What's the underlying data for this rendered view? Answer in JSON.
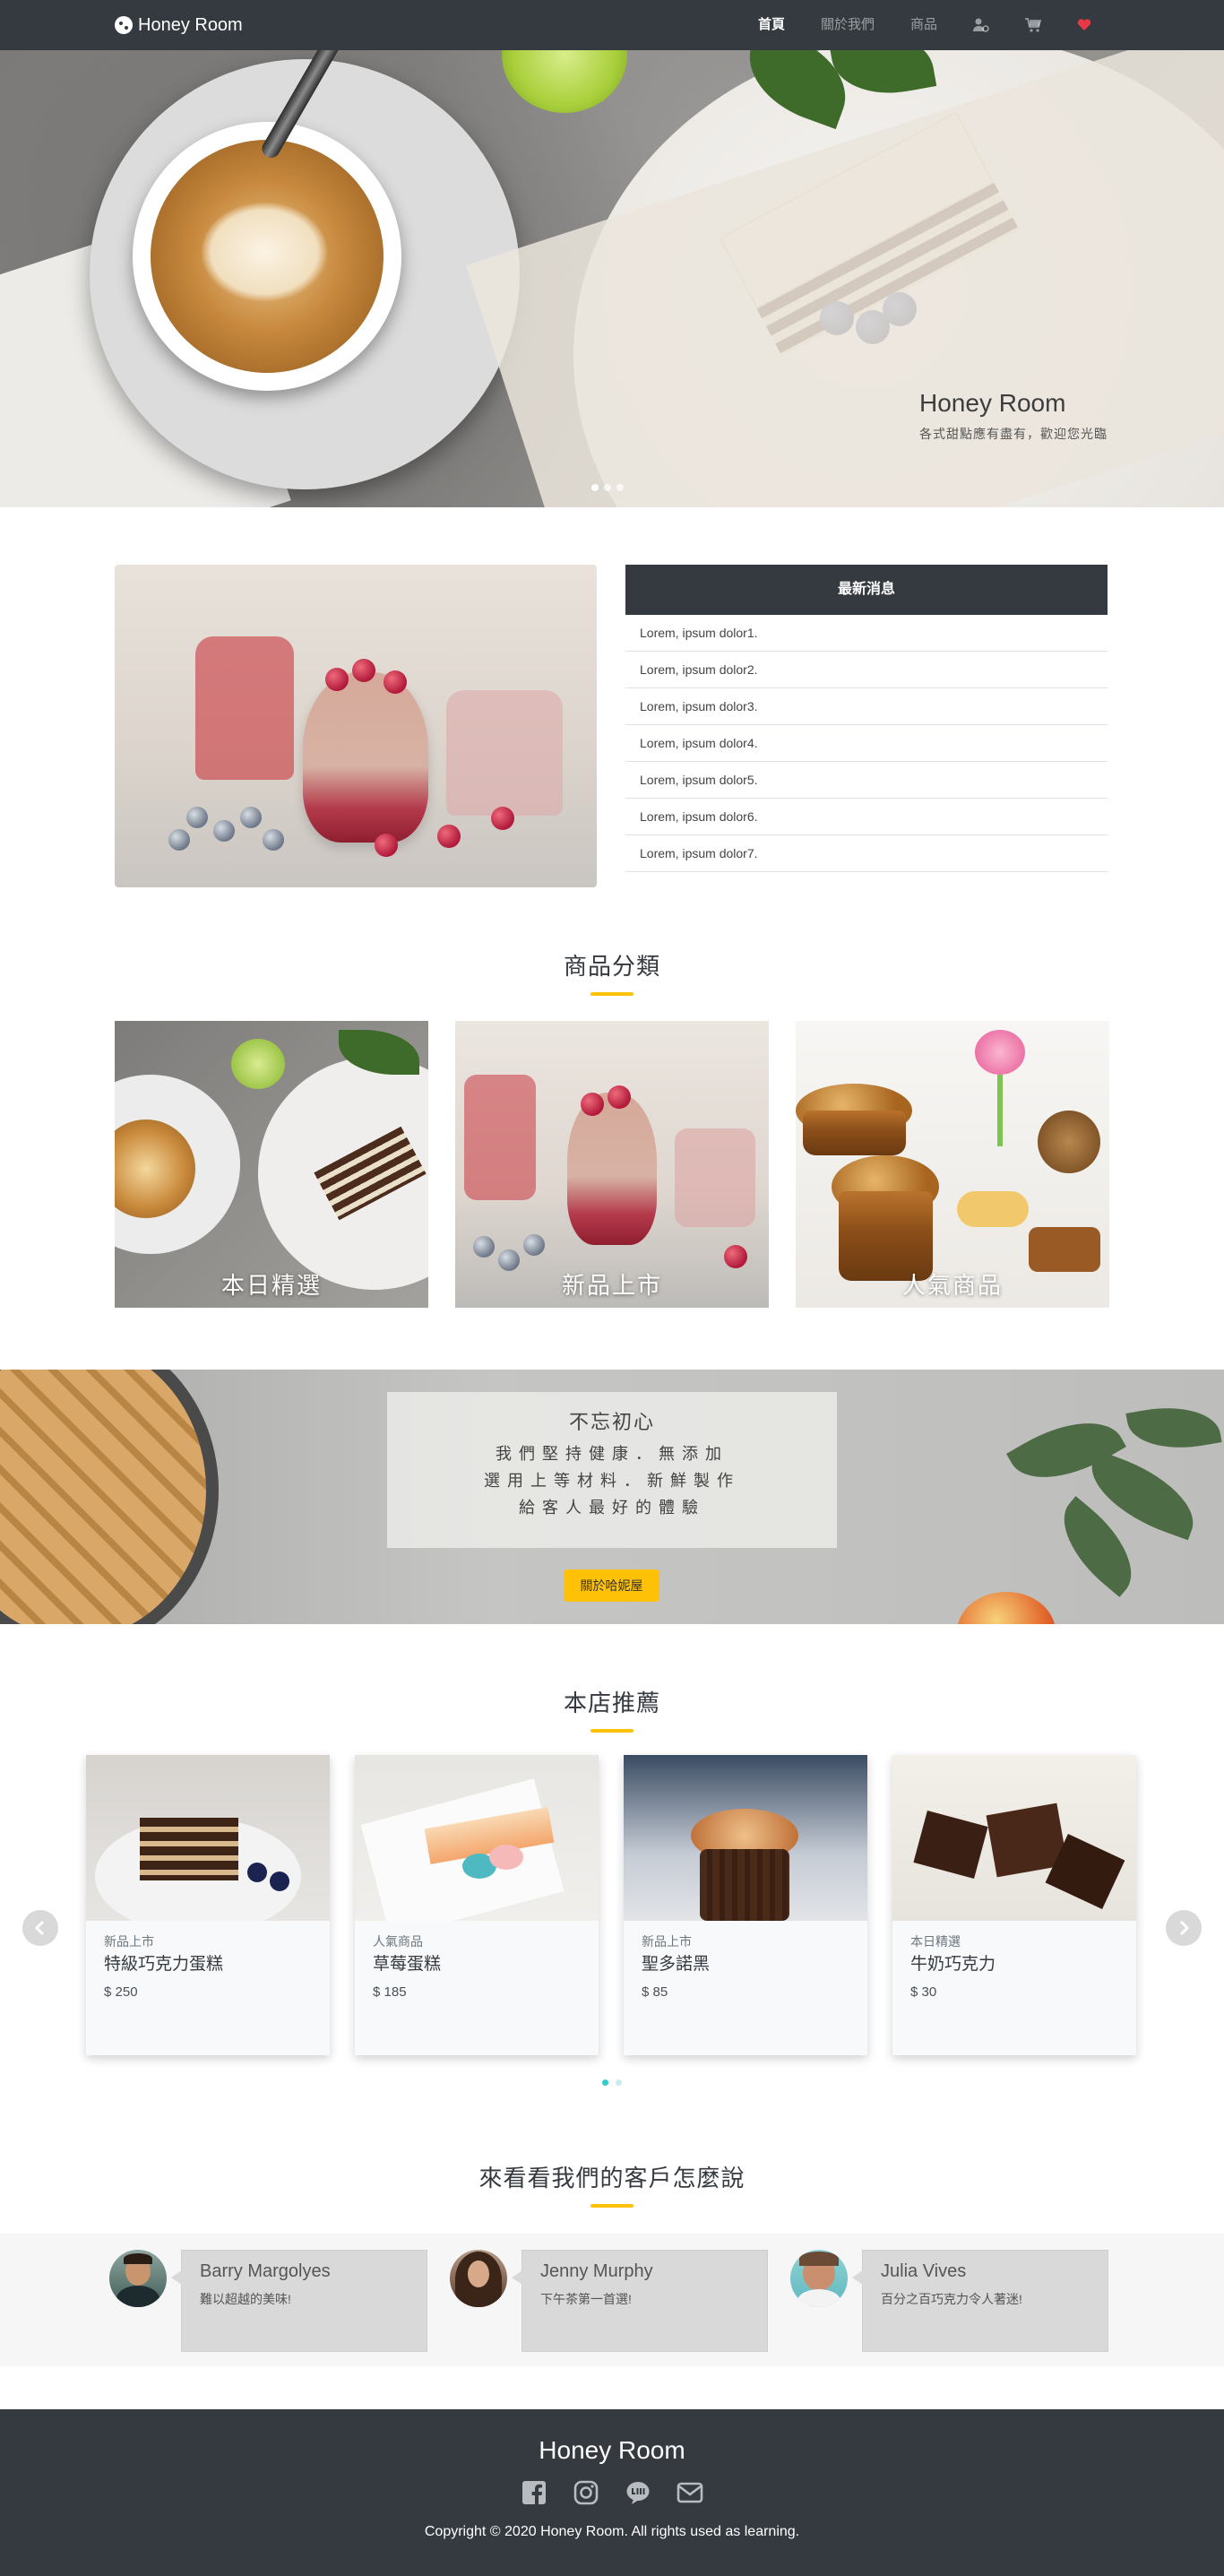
{
  "navbar": {
    "brand": "Honey Room",
    "items": [
      {
        "label": "首頁",
        "active": true
      },
      {
        "label": "關於我們",
        "active": false
      },
      {
        "label": "商品",
        "active": false
      }
    ],
    "icons": [
      "user-cog-icon",
      "cart-icon",
      "heart-icon"
    ]
  },
  "hero": {
    "title": "Honey Room",
    "subtitle": "各式甜點應有盡有，歡迎您光臨",
    "slides": 3,
    "active_slide": 1
  },
  "news": {
    "heading": "最新消息",
    "items": [
      "Lorem, ipsum dolor1.",
      "Lorem, ipsum dolor2.",
      "Lorem, ipsum dolor3.",
      "Lorem, ipsum dolor4.",
      "Lorem, ipsum dolor5.",
      "Lorem, ipsum dolor6.",
      "Lorem, ipsum dolor7."
    ]
  },
  "categories": {
    "title": "商品分類",
    "items": [
      "本日精選",
      "新品上市",
      "人氣商品"
    ]
  },
  "banner": {
    "heading": "不忘初心",
    "lines": [
      "我們堅持健康．無添加",
      "選用上等材料．新鮮製作",
      "給客人最好的體驗"
    ],
    "button": "關於哈妮屋"
  },
  "recommended": {
    "title": "本店推薦",
    "products": [
      {
        "tag": "新品上市",
        "name": "特級巧克力蛋糕",
        "price": "$ 250"
      },
      {
        "tag": "人氣商品",
        "name": "草莓蛋糕",
        "price": "$ 185"
      },
      {
        "tag": "新品上市",
        "name": "聖多諾黑",
        "price": "$ 85"
      },
      {
        "tag": "本日精選",
        "name": "牛奶巧克力",
        "price": "$ 30"
      }
    ],
    "pages": 2,
    "active_page": 1
  },
  "testimonials": {
    "title": "來看看我們的客戶怎麼說",
    "items": [
      {
        "name": "Barry Margolyes",
        "quote": "難以超越的美味!"
      },
      {
        "name": "Jenny Murphy",
        "quote": "下午茶第一首選!"
      },
      {
        "name": "Julia Vives",
        "quote": "百分之百巧克力令人著迷!"
      }
    ]
  },
  "footer": {
    "brand": "Honey Room",
    "social": [
      "facebook-icon",
      "instagram-icon",
      "line-icon",
      "mail-icon"
    ],
    "copyright": "Copyright © 2020 Honey Room. All rights used as learning."
  },
  "colors": {
    "dark": "#343a40",
    "accent": "#ffc107",
    "teal": "#33cccc",
    "heart": "#e63946"
  }
}
